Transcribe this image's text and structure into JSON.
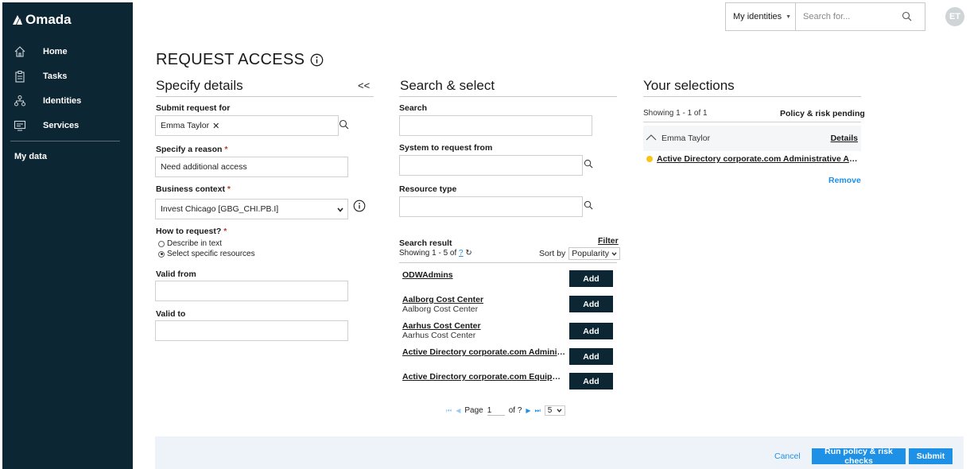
{
  "sidebar": {
    "logo": "Omada",
    "items": [
      {
        "label": "Home",
        "icon": "home-icon"
      },
      {
        "label": "Tasks",
        "icon": "tasks-icon"
      },
      {
        "label": "Identities",
        "icon": "identities-icon"
      },
      {
        "label": "Services",
        "icon": "services-icon"
      }
    ],
    "my_data": "My data"
  },
  "header": {
    "identity_selector": "My identities",
    "search_placeholder": "Search for...",
    "avatar_initials": "ET"
  },
  "page": {
    "title": "REQUEST ACCESS"
  },
  "details": {
    "title": "Specify details",
    "collapse": "<<",
    "submit_for_label": "Submit request for",
    "submit_for_value": "Emma Taylor",
    "reason_label": "Specify a reason",
    "reason_value": "Need additional access",
    "business_context_label": "Business context",
    "business_context_value": "Invest Chicago [GBG_CHI.PB.I]",
    "how_label": "How to request?",
    "how_options": [
      "Describe in text",
      "Select specific resources"
    ],
    "how_selected": 1,
    "valid_from_label": "Valid from",
    "valid_to_label": "Valid to",
    "required_mark": "*"
  },
  "search_select": {
    "title": "Search & select",
    "search_label": "Search",
    "system_label": "System to request from",
    "resource_type_label": "Resource type",
    "result_label": "Search result",
    "filter_label": "Filter",
    "showing_text": "Showing 1 - 5 of",
    "showing_total": "?",
    "sort_label": "Sort by",
    "sort_value": "Popularity",
    "results": [
      {
        "name": "ODWAdmins",
        "sub": ""
      },
      {
        "name": "Aalborg Cost Center",
        "sub": "Aalborg Cost Center"
      },
      {
        "name": "Aarhus Cost Center",
        "sub": "Aarhus Cost Center"
      },
      {
        "name": "Active Directory corporate.com Administ...",
        "sub": ""
      },
      {
        "name": "Active Directory corporate.com Equipme...",
        "sub": ""
      }
    ],
    "add_label": "Add",
    "pager": {
      "page_label": "Page",
      "page_value": "1",
      "of_label": "of ?",
      "page_size": "5"
    }
  },
  "selections": {
    "title": "Your selections",
    "showing": "Showing 1 - 1 of 1",
    "status": "Policy & risk pending",
    "identity": "Emma Taylor",
    "details_link": "Details",
    "item": "Active Directory corporate.com Administrative Acc...",
    "remove": "Remove"
  },
  "footer": {
    "cancel": "Cancel",
    "run_checks": "Run policy & risk checks",
    "submit": "Submit"
  },
  "colors": {
    "sidebar_bg": "#0d2633",
    "accent": "#1e90e6",
    "pending": "#f5c518",
    "footer_bg": "#eef3f9"
  }
}
